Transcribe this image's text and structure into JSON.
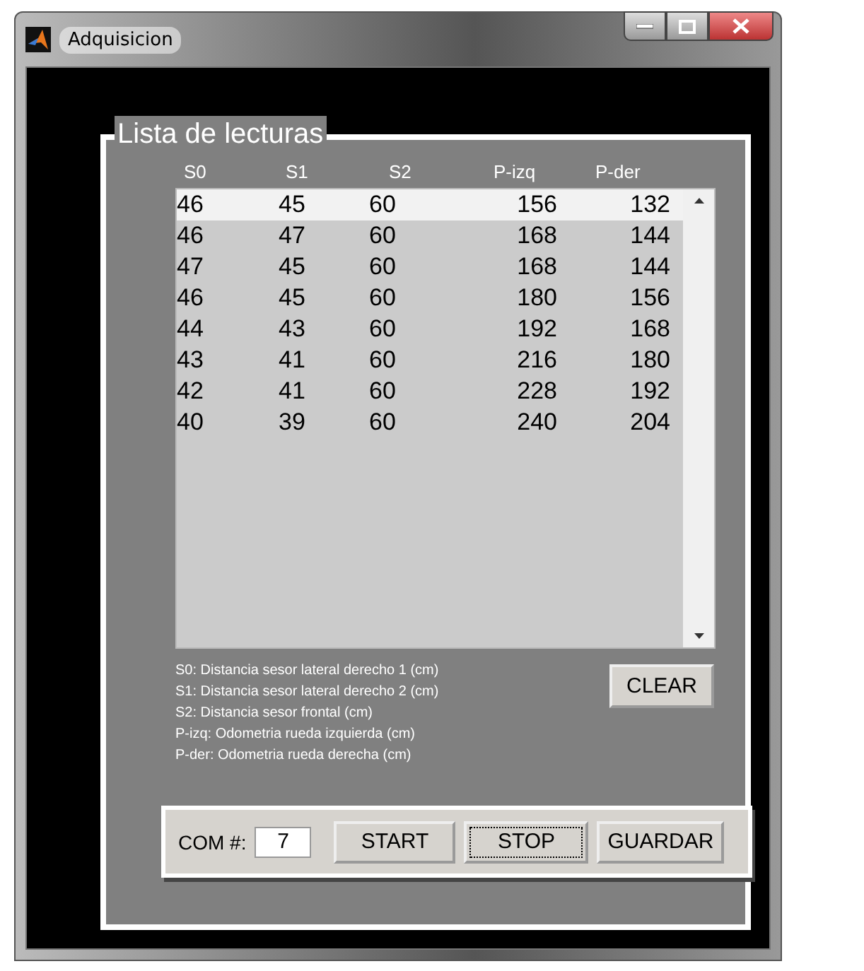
{
  "window": {
    "title": "Adquisicion"
  },
  "panel": {
    "title": "Lista de lecturas"
  },
  "table": {
    "columns": [
      "S0",
      "S1",
      "S2",
      "P-izq",
      "P-der"
    ],
    "rows": [
      {
        "cells": [
          "46",
          "45",
          "60",
          "156",
          "132"
        ],
        "selected": true
      },
      {
        "cells": [
          "46",
          "47",
          "60",
          "168",
          "144"
        ],
        "selected": false
      },
      {
        "cells": [
          "47",
          "45",
          "60",
          "168",
          "144"
        ],
        "selected": false
      },
      {
        "cells": [
          "46",
          "45",
          "60",
          "180",
          "156"
        ],
        "selected": false
      },
      {
        "cells": [
          "44",
          "43",
          "60",
          "192",
          "168"
        ],
        "selected": false
      },
      {
        "cells": [
          "43",
          "41",
          "60",
          "216",
          "180"
        ],
        "selected": false
      },
      {
        "cells": [
          "42",
          "41",
          "60",
          "228",
          "192"
        ],
        "selected": false
      },
      {
        "cells": [
          "40",
          "39",
          "60",
          "240",
          "204"
        ],
        "selected": false
      }
    ]
  },
  "legend": [
    "S0: Distancia sesor lateral derecho 1 (cm)",
    "S1: Distancia sesor lateral derecho 2 (cm)",
    "S2: Distancia sesor frontal (cm)",
    "P-izq:  Odometria rueda izquierda (cm)",
    "P-der: Odometria rueda derecha (cm)"
  ],
  "clear_button": "CLEAR",
  "toolbar": {
    "com_label": "COM #:",
    "com_value": "7",
    "buttons": [
      {
        "label": "START",
        "focused": false
      },
      {
        "label": "STOP",
        "focused": true
      },
      {
        "label": "GUARDAR",
        "focused": false
      }
    ]
  }
}
